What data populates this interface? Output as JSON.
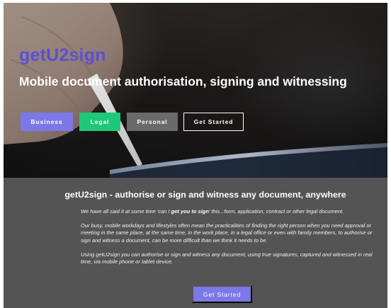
{
  "hero": {
    "brand": "getU2sign",
    "tagline": "Mobile document authorisation, signing and witnessing",
    "buttons": {
      "business": "Business",
      "legal": "Legal",
      "personal": "Personal",
      "get_started": "Get Started"
    }
  },
  "content": {
    "title": "getU2sign - authorise or sign and witness any document, anywhere",
    "p1_before": "We have all said it at some time 'can I ",
    "p1_bold": "get you to sign",
    "p1_after": "' this...form, application, contract or other legal document.",
    "p2": "Our busy, mobile workdays and lifestyles often mean the practicalities of finding the right person when you need approval or meeting in the same place, at the same time, in the work place, in a legal office or even with family members, to authorise or sign and witness a document, can be more difficult than we think it needs to be.",
    "p3": "Using getU2sign you can authorise or sign and witness any document, using true signatures, captured and witnessed in real time, via mobile phone or tablet device.",
    "cta": "Get Started"
  },
  "colors": {
    "brand": "#5a4fd6",
    "business": "#7c78e8",
    "legal": "#1fc878",
    "personal": "#6a6a6a",
    "content_bg": "#545454"
  }
}
